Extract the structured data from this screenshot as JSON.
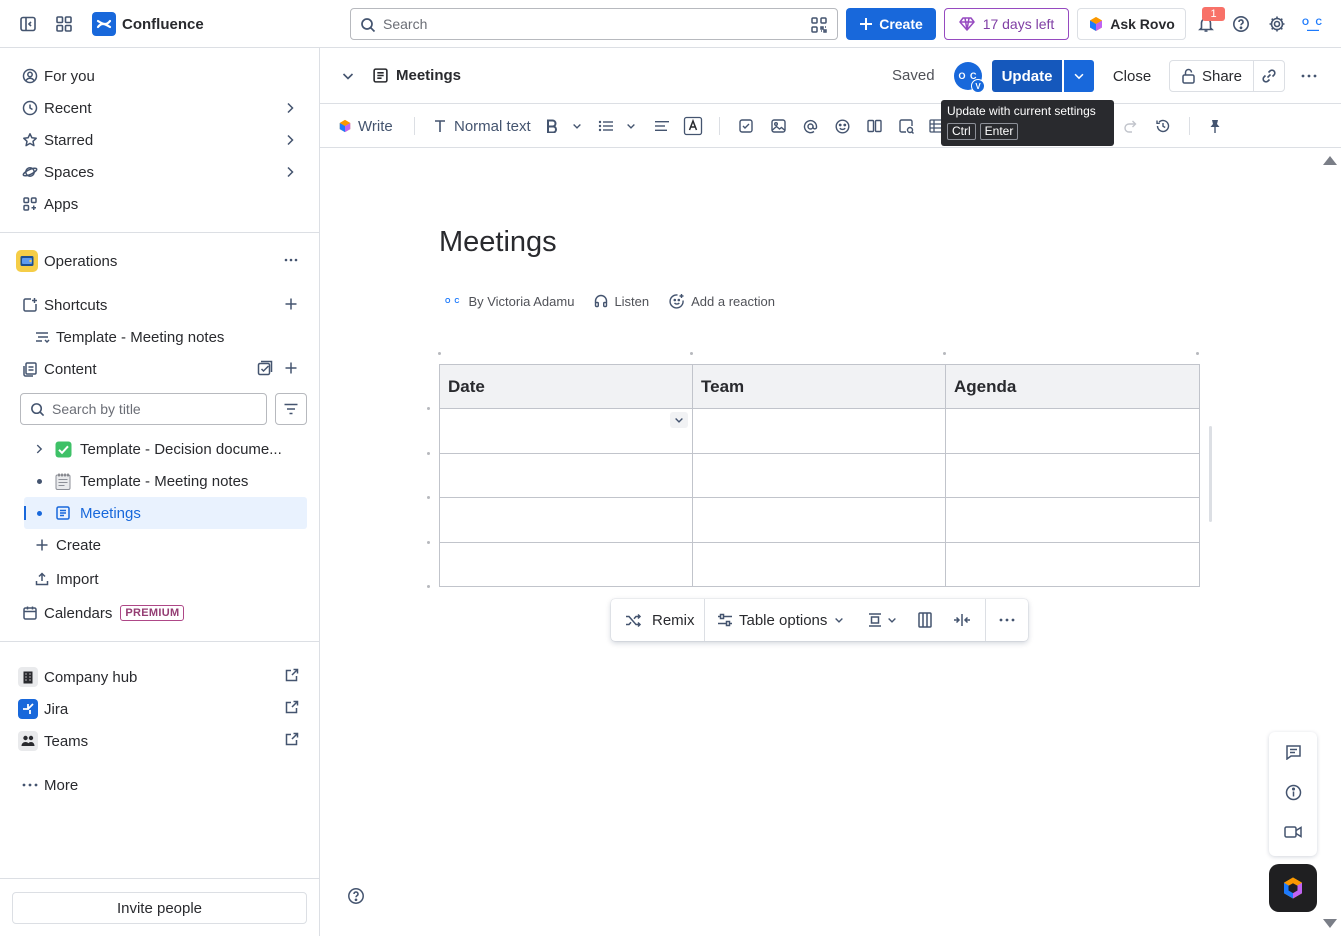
{
  "topbar": {
    "app_name": "Confluence",
    "search_placeholder": "Search",
    "create_label": "Create",
    "trial_label": "17 days left",
    "rovo_label": "Ask Rovo",
    "notification_count": "1",
    "avatar_initials": "O C"
  },
  "sidebar": {
    "nav": [
      {
        "label": "For you"
      },
      {
        "label": "Recent"
      },
      {
        "label": "Starred"
      },
      {
        "label": "Spaces"
      },
      {
        "label": "Apps"
      }
    ],
    "space_name": "Operations",
    "shortcuts_label": "Shortcuts",
    "shortcut_item": "Template - Meeting notes",
    "content_label": "Content",
    "search_placeholder": "Search by title",
    "tree": [
      {
        "label": "Template - Decision docume..."
      },
      {
        "label": "Template - Meeting notes"
      },
      {
        "label": "Meetings"
      }
    ],
    "create_label": "Create",
    "import_label": "Import",
    "calendars_label": "Calendars",
    "premium_badge": "PREMIUM",
    "apps": [
      {
        "label": "Company hub"
      },
      {
        "label": "Jira"
      },
      {
        "label": "Teams"
      }
    ],
    "more_label": "More",
    "invite_label": "Invite people"
  },
  "header": {
    "page_title": "Meetings",
    "saved_label": "Saved",
    "collab_initials": "O C",
    "collab_badge": "V",
    "update_label": "Update",
    "close_label": "Close",
    "share_label": "Share"
  },
  "tooltip": {
    "text": "Update with current settings",
    "key1": "Ctrl",
    "key2": "Enter"
  },
  "toolbar": {
    "write_label": "Write",
    "text_style_label": "Normal text"
  },
  "document": {
    "title": "Meetings",
    "author_initials": "O C",
    "author": "By Victoria Adamu",
    "listen_label": "Listen",
    "reaction_label": "Add a reaction",
    "table": {
      "headers": [
        "Date",
        "Team",
        "Agenda"
      ],
      "rows": [
        [
          "",
          "",
          ""
        ],
        [
          "",
          "",
          ""
        ],
        [
          "",
          "",
          ""
        ],
        [
          "",
          "",
          ""
        ]
      ]
    }
  },
  "floating_toolbar": {
    "remix_label": "Remix",
    "table_options_label": "Table options"
  },
  "colors": {
    "brand": "#1868db",
    "trial": "#803fa5",
    "premium": "#943d73"
  }
}
